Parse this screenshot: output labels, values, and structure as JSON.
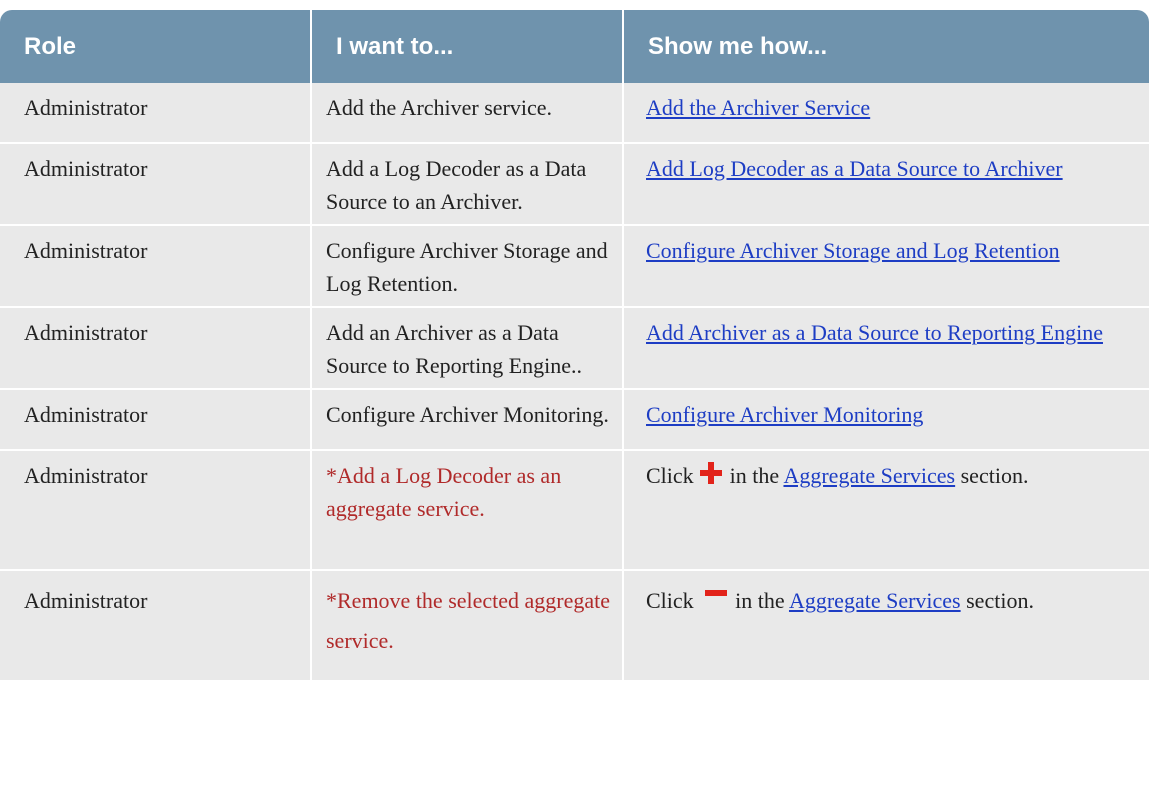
{
  "table": {
    "headers": [
      "Role",
      "I want to...",
      "Show me how..."
    ],
    "rows": [
      {
        "role": "Administrator",
        "task": "Add the Archiver service.",
        "how_link": "Add the Archiver Service"
      },
      {
        "role": "Administrator",
        "task": "Add a Log Decoder as a Data Source to an Archiver.",
        "how_link": "Add Log Decoder as a Data Source to Archiver"
      },
      {
        "role": "Administrator",
        "task": "Configure Archiver Storage and Log Retention.",
        "how_link": "Configure Archiver Storage and Log Retention"
      },
      {
        "role": "Administrator",
        "task": "Add an Archiver as a Data Source to Reporting Engine..",
        "how_link": "Add Archiver as a Data Source to Reporting Engine"
      },
      {
        "role": "Administrator",
        "task": "Configure Archiver Monitoring.",
        "how_link": "Configure Archiver Monitoring"
      },
      {
        "role": "Administrator",
        "task": "*Add a Log Decoder as an aggregate service.",
        "how_prefix": "Click",
        "how_icon": "plus-icon",
        "how_middle": "in the",
        "how_link": "Aggregate Services",
        "how_suffix": "section."
      },
      {
        "role": "Administrator",
        "task": "*Remove the selected aggregate service.",
        "how_prefix": "Click",
        "how_icon": "minus-icon",
        "how_middle": "in the",
        "how_link": "Aggregate Services",
        "how_suffix": "section."
      }
    ]
  },
  "colors": {
    "header_bg": "#6f93ad",
    "row_bg": "#e9e9e9",
    "link": "#1d3dc4",
    "optional_text": "#b02a2a",
    "icon_red": "#e2231a"
  }
}
